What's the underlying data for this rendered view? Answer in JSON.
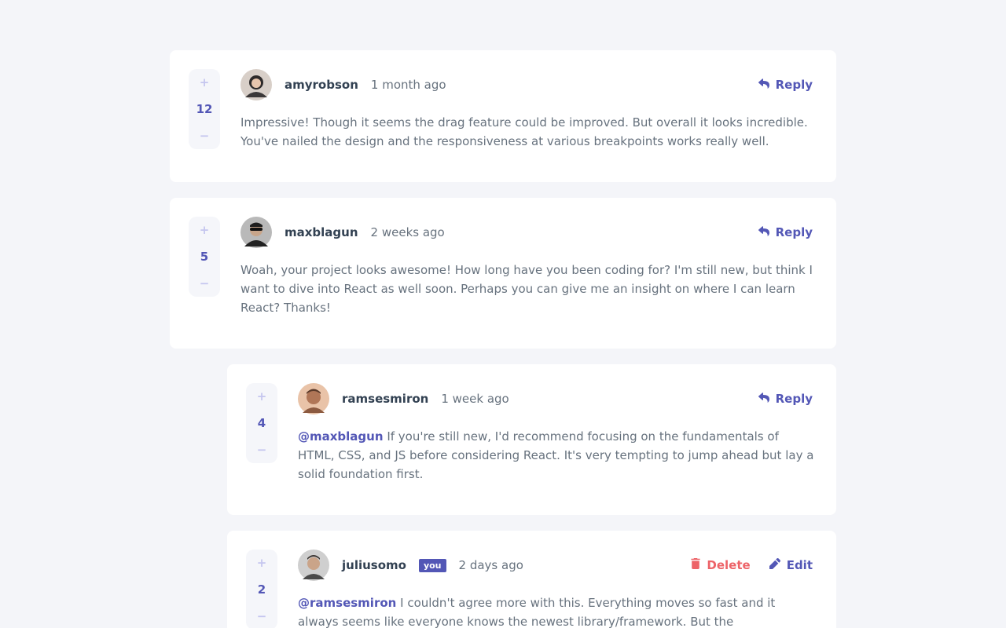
{
  "labels": {
    "reply": "Reply",
    "delete": "Delete",
    "edit": "Edit",
    "you": "you",
    "upvote": "+",
    "downvote": "−"
  },
  "colors": {
    "background": "#f4f5f9",
    "accent": "#5357b6",
    "danger": "#ed6368",
    "card": "#ffffff"
  },
  "comments": [
    {
      "score": "12",
      "username": "amyrobson",
      "date": "1 month ago",
      "avatar_icon": "user-avatar-amyrobson",
      "content": "Impressive! Though it seems the drag feature could be improved. But overall it looks incredible. You've nailed the design and the responsiveness at various breakpoints works really well."
    },
    {
      "score": "5",
      "username": "maxblagun",
      "date": "2 weeks ago",
      "avatar_icon": "user-avatar-maxblagun",
      "content": "Woah, your project looks awesome! How long have you been coding for? I'm still new, but think I want to dive into React as well soon. Perhaps you can give me an insight on where I can learn React? Thanks!"
    },
    {
      "score": "4",
      "username": "ramsesmiron",
      "date": "1 week ago",
      "avatar_icon": "user-avatar-ramsesmiron",
      "mention": "@maxblagun",
      "content": "If you're still new, I'd recommend focusing on the fundamentals of HTML, CSS, and JS before considering React. It's very tempting to jump ahead but lay a solid foundation first."
    },
    {
      "score": "2",
      "username": "juliusomo",
      "date": "2 days ago",
      "avatar_icon": "user-avatar-juliusomo",
      "mention": "@ramsesmiron",
      "content": "I couldn't agree more with this. Everything moves so fast and it always seems like everyone knows the newest library/framework. But the fundamentals are what"
    }
  ]
}
